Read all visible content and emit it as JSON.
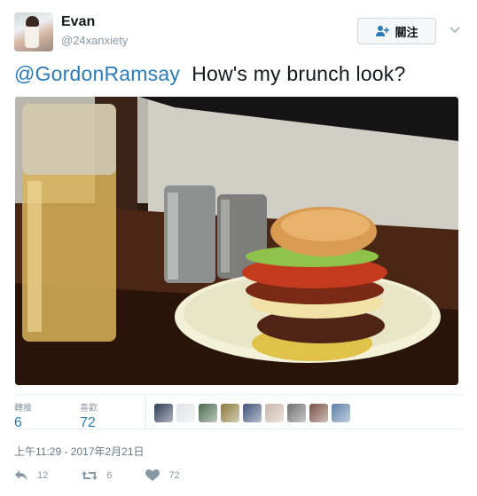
{
  "user": {
    "display_name": "Evan",
    "handle": "@24xanxiety",
    "follow_label": "關注"
  },
  "tweet": {
    "mention": "@GordonRamsay",
    "text": "How's my brunch look?"
  },
  "stats": {
    "retweets_label": "轉推",
    "retweets_count": "6",
    "likes_label": "喜歡",
    "likes_count": "72"
  },
  "liker_avatars": [
    "#2d3a55",
    "#dfe3e8",
    "#4a6b4e",
    "#8b7a3a",
    "#3f5277",
    "#c9b7a8",
    "#6f6f6f",
    "#7a4f45",
    "#5c7fa8"
  ],
  "timestamp": "上午11:29 - 2017年2月21日",
  "actions": {
    "reply_count": "12",
    "retweet_count": "6",
    "like_count": "72"
  },
  "colors": {
    "link": "#2b7bb9",
    "muted": "#8899a6",
    "border": "#e6ecf0"
  },
  "icons": [
    "follow-person-plus-icon",
    "chevron-down-icon",
    "reply-icon",
    "retweet-icon",
    "heart-icon"
  ]
}
